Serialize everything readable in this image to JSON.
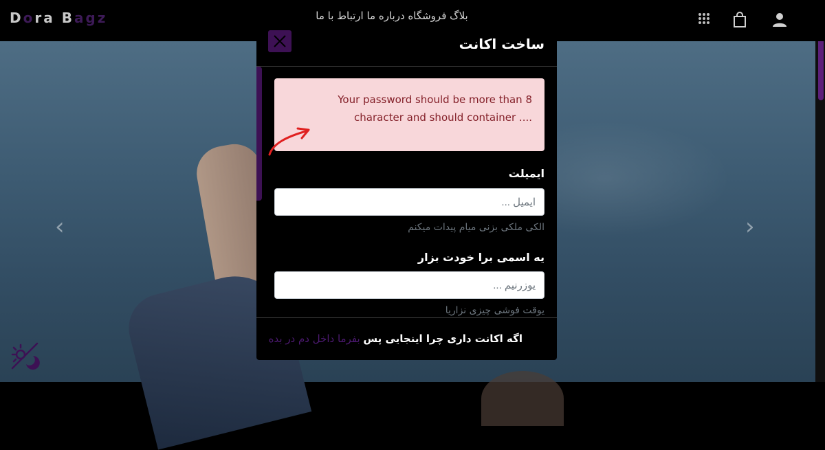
{
  "brand": {
    "part1": "D",
    "part2": "o",
    "part3": "ra ",
    "part4": "B",
    "part5": "ag",
    "part6": "z"
  },
  "nav": {
    "center_text": "بلاگ   فروشگاه   درباره ما   ارتباط با ما",
    "icons": [
      "grid-icon",
      "shopping-bag-icon",
      "user-icon"
    ]
  },
  "modal": {
    "title": "ساخت اکانت",
    "alert_line1": "Your password should be more than 8",
    "alert_line2": "character and should container ....",
    "email": {
      "label": "ایمیلت",
      "placeholder": "ایمیل ...",
      "hint": "الکی ملکی بزنی میام پیدات میکنم"
    },
    "username": {
      "label": "یه اسمی برا خودت بزار",
      "placeholder": "یوزرنیم ...",
      "hint": "یوقت فوشی چیزی نزاریا"
    },
    "footer": {
      "question": "اگه اکانت داری چرا اینجایی پس",
      "link": "بفرما داخل دم در بده"
    }
  },
  "colors": {
    "accent": "#3d1154",
    "alert_bg": "#f8d7da",
    "alert_text": "#842029",
    "link": "#4d1a72"
  }
}
